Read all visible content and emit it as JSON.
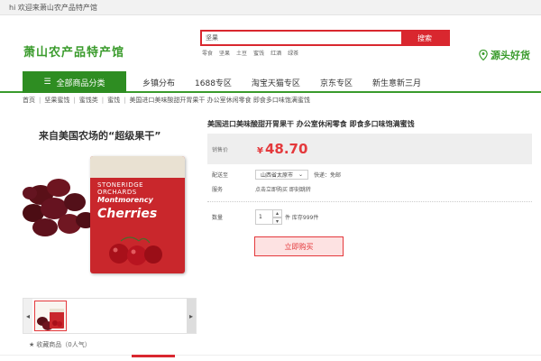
{
  "topbar": {
    "welcome": "hi 欢迎来萧山农产品特产馆"
  },
  "header": {
    "logo_text": "萧山农产品特产馆",
    "search": {
      "value": "坚果",
      "button_label": "搜索"
    },
    "hot_words": [
      "零食",
      "坚果",
      "土豆",
      "蜜饯",
      "红酒",
      "绿茶"
    ],
    "slogan": "源头好货"
  },
  "nav": {
    "category_button": "全部商品分类",
    "items": [
      "乡镇分布",
      "1688专区",
      "淘宝天猫专区",
      "京东专区",
      "新生意新三月"
    ]
  },
  "breadcrumb": [
    "首页",
    "坚果蜜饯",
    "蜜饯类",
    "蜜饯",
    "美国进口美味酸甜开胃果干 办公室休闲零食 即食多口味饱满蜜饯"
  ],
  "gallery": {
    "hero_text": "来自美国农场的“超级果干”",
    "pack_brand": "STONERIDGE ORCHARDS",
    "pack_product_line1": "Montmorency",
    "pack_product_line2": "Cherries"
  },
  "favorite": {
    "label": "收藏商品（0人气）"
  },
  "product": {
    "title": "美国进口美味酸甜开胃果干 办公室休闲零食 即食多口味饱满蜜饯",
    "price_label": "销售价",
    "currency": "¥",
    "price": "48.70",
    "shipping_label": "配送至",
    "address": "山西省太原市",
    "shipping_fee": "快递：免邮",
    "service_label": "服务",
    "service_text": "点击立即购买 即刻跳转",
    "quantity_label": "数量",
    "quantity": "1",
    "stock_text": "件 库存999件",
    "buy_button": "立即购买"
  },
  "colors": {
    "brand_green": "#3a9b2c",
    "accent_red": "#d9272f",
    "price_red": "#e4393c"
  }
}
